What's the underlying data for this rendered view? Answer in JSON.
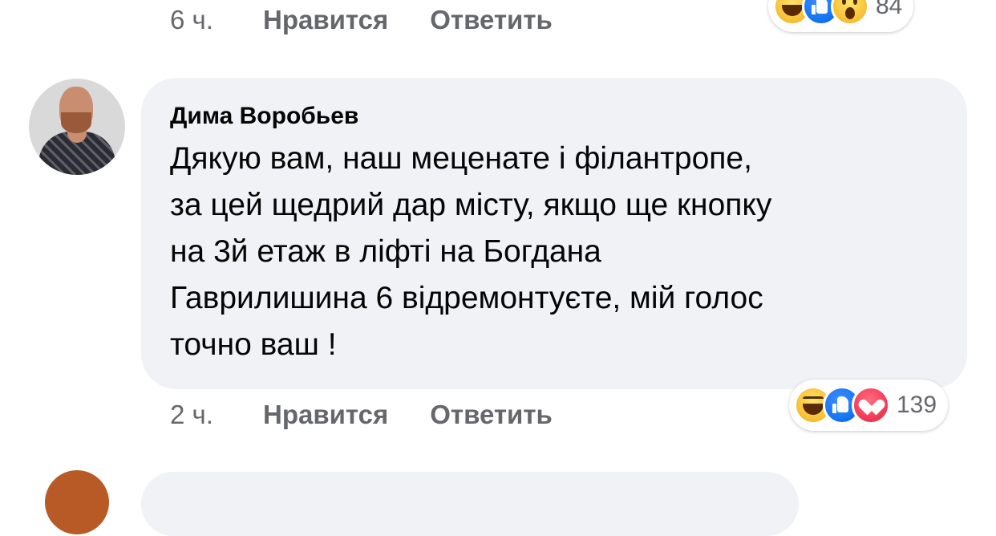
{
  "previous_comment": {
    "time": "6 ч.",
    "like_label": "Нравится",
    "reply_label": "Ответить",
    "reactions": [
      "haha",
      "like",
      "wow"
    ],
    "reaction_count": "84"
  },
  "comment": {
    "author": "Дима Воробьев",
    "lines": [
      "Дякую вам, наш меценате і філантропе,",
      "за цей щедрий дар місту, якщо ще кнопку",
      "на 3й етаж в ліфті на Богдана",
      "Гаврилишина 6 відремонтуєте, мій голос",
      "точно ваш !"
    ],
    "time": "2 ч.",
    "like_label": "Нравится",
    "reply_label": "Ответить",
    "reactions": [
      "haha",
      "like",
      "love"
    ],
    "reaction_count": "139"
  },
  "colors": {
    "bubble": "#f0f2f5",
    "meta_text": "#65676b",
    "text": "#050505",
    "like_blue": "#1877f2",
    "love_red": "#f33e58",
    "haha_yellow": "#f8c43a"
  }
}
